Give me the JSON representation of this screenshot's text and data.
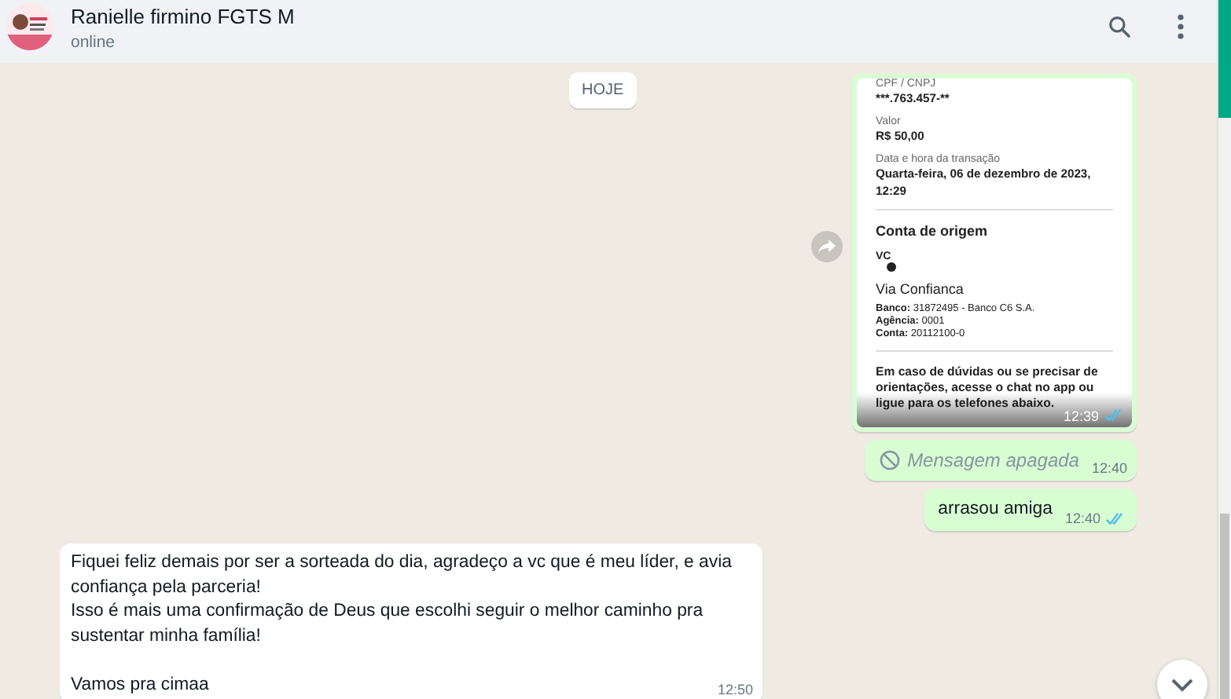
{
  "header": {
    "name": "Ranielle firmino FGTS M",
    "status": "online"
  },
  "date_chip": "HOJE",
  "messages": [
    {
      "outgoing": true,
      "time": "12:39",
      "read": true,
      "receipt": {
        "fields": [
          {
            "label": "CPF / CNPJ",
            "value": "***.763.457-**"
          },
          {
            "label": "Valor",
            "value": "R$ 50,00"
          },
          {
            "label": "Data e hora da transação",
            "value": "Quarta-feira, 06 de dezembro de 2023, 12:29"
          }
        ],
        "section_title": "Conta de origem",
        "logo": "VC",
        "account_name": "Via Confianca",
        "details": [
          "**Banco:** 31872495 - Banco C6 S.A.",
          "**Agência:** 0001",
          "**Conta:** 20112100-0"
        ],
        "notice": "Em caso de dúvidas ou se precisar de orientações, acesse o chat no app ou ligue para os telefones abaixo."
      }
    },
    {
      "kind": "deleted",
      "outgoing": true,
      "text": "Mensagem apagada",
      "time": "12:40"
    },
    {
      "kind": "text",
      "outgoing": true,
      "text": "arrasou amiga",
      "time": "12:40",
      "read": true
    },
    {
      "kind": "text",
      "outgoing": false,
      "text": "Fiquei feliz demais por ser a sorteada do dia, agradeço a vc que é meu líder, e avia confiança pela parceria!\nIsso é mais uma confirmação de Deus que escolhi seguir o melhor caminho pra sustentar minha família!\n\nVamos pra cimaa",
      "time": "12:50"
    }
  ]
}
